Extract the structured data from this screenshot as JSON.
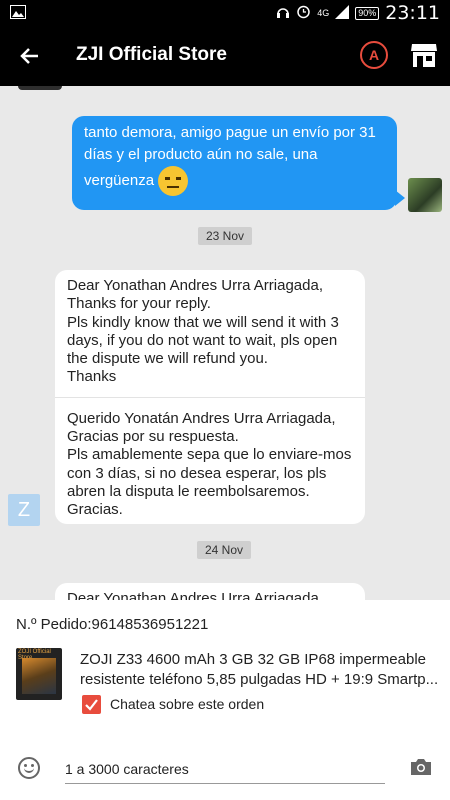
{
  "status_bar": {
    "network": "4G",
    "battery": "90%",
    "time": "23:11"
  },
  "header": {
    "title": "ZJI Official Store",
    "translate_label": "A"
  },
  "messages": {
    "outgoing_text": "tanto demora, amigo pague un envío por 31 días y el producto aún no sale, una vergüenza",
    "date_1": "23 Nov",
    "incoming_en": "Dear Yonathan Andres Urra Arriagada,\nThanks for your reply.\nPls kindly know that we will send it with 3 days, if you do not want to wait, pls open the dispute we will refund you.\nThanks",
    "incoming_es": "Querido Yonatán Andres Urra Arriagada,\nGracias por su respuesta.\nPls amablemente sepa que lo enviare-mos con 3 días, si no desea esperar, los pls abren la disputa le reembolsaremos.\nGracias.",
    "seller_avatar_letter": "Z",
    "date_2": "24 Nov",
    "partial_text": "Dear Yonathan Andres Urra Arriagada,"
  },
  "order": {
    "number_label": "N.º Pedido:96148536951221",
    "product_brand": "ZOJI Official Store",
    "product_title_line1": "ZOJI Z33 4600 mAh 3 GB 32 GB IP68 impermeable",
    "product_title_line2": "resistente teléfono 5,85 pulgadas HD + 19:9 Smartp...",
    "chat_checkbox_label": "Chatea sobre este orden",
    "chat_checkbox_checked": true
  },
  "input": {
    "placeholder": "1 a 3000 caracteres"
  },
  "colors": {
    "outgoing_bubble": "#2196f3",
    "accent_red": "#e84c3d",
    "header_bg": "#000000"
  }
}
